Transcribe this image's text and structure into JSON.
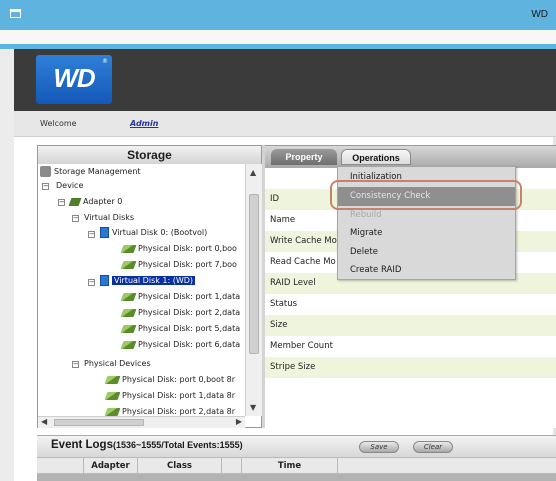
{
  "window": {
    "title": "WD",
    "accent": "#5fb3df"
  },
  "header": {
    "logo_text": "WD",
    "logo_mark": "®",
    "welcome_label": "Welcome",
    "user": "Admin"
  },
  "storage": {
    "title": "Storage",
    "tree": [
      {
        "label": "Storage Management",
        "icon": "storage-management-icon"
      },
      {
        "label": "Device",
        "icon": "folder-icon"
      },
      {
        "label": "Adapter 0",
        "icon": "adapter-icon"
      },
      {
        "label": "Virtual Disks",
        "icon": "folder-icon"
      },
      {
        "label": "Virtual Disk 0: (Bootvol)",
        "icon": "virtual-disk-icon"
      },
      {
        "label": "Physical Disk: port 0,boo",
        "icon": "physical-disk-icon"
      },
      {
        "label": "Physical Disk: port 7,boo",
        "icon": "physical-disk-icon"
      },
      {
        "label": "Virtual Disk 1: (WD)",
        "icon": "virtual-disk-icon",
        "selected": true
      },
      {
        "label": "Physical Disk: port 1,data",
        "icon": "physical-disk-icon"
      },
      {
        "label": "Physical Disk: port 2,data",
        "icon": "physical-disk-icon"
      },
      {
        "label": "Physical Disk: port 5,data",
        "icon": "physical-disk-icon"
      },
      {
        "label": "Physical Disk: port 6,data",
        "icon": "physical-disk-icon"
      },
      {
        "label": "Physical Devices",
        "icon": "folder-icon"
      },
      {
        "label": "Physical Disk: port 0,boot 8r",
        "icon": "physical-disk-icon"
      },
      {
        "label": "Physical Disk: port 1,data 8r",
        "icon": "physical-disk-icon"
      },
      {
        "label": "Physical Disk: port 2,data 8r",
        "icon": "physical-disk-icon"
      }
    ]
  },
  "tabs": {
    "property": "Property",
    "operations": "Operations"
  },
  "properties": [
    {
      "label": ""
    },
    {
      "label": "ID"
    },
    {
      "label": "Name"
    },
    {
      "label": "Write Cache Mo"
    },
    {
      "label": "Read Cache Mo"
    },
    {
      "label": "RAID Level"
    },
    {
      "label": "Status"
    },
    {
      "label": "Size"
    },
    {
      "label": "Member Count"
    },
    {
      "label": "Stripe Size"
    }
  ],
  "operations_menu": {
    "items": [
      {
        "label": "Initialization"
      },
      {
        "label": "Consistency Check",
        "highlighted": true
      },
      {
        "label": "Rebuild",
        "disabled": true
      },
      {
        "label": "Migrate"
      },
      {
        "label": "Delete"
      },
      {
        "label": "Create RAID"
      }
    ]
  },
  "event_logs": {
    "title": "Event Logs",
    "count": "(1536~1555/Total Events:1555)",
    "save_label": "Save",
    "clear_label": "Clear",
    "columns": [
      "",
      "Adapter",
      "Class",
      "",
      "Time",
      ""
    ]
  }
}
